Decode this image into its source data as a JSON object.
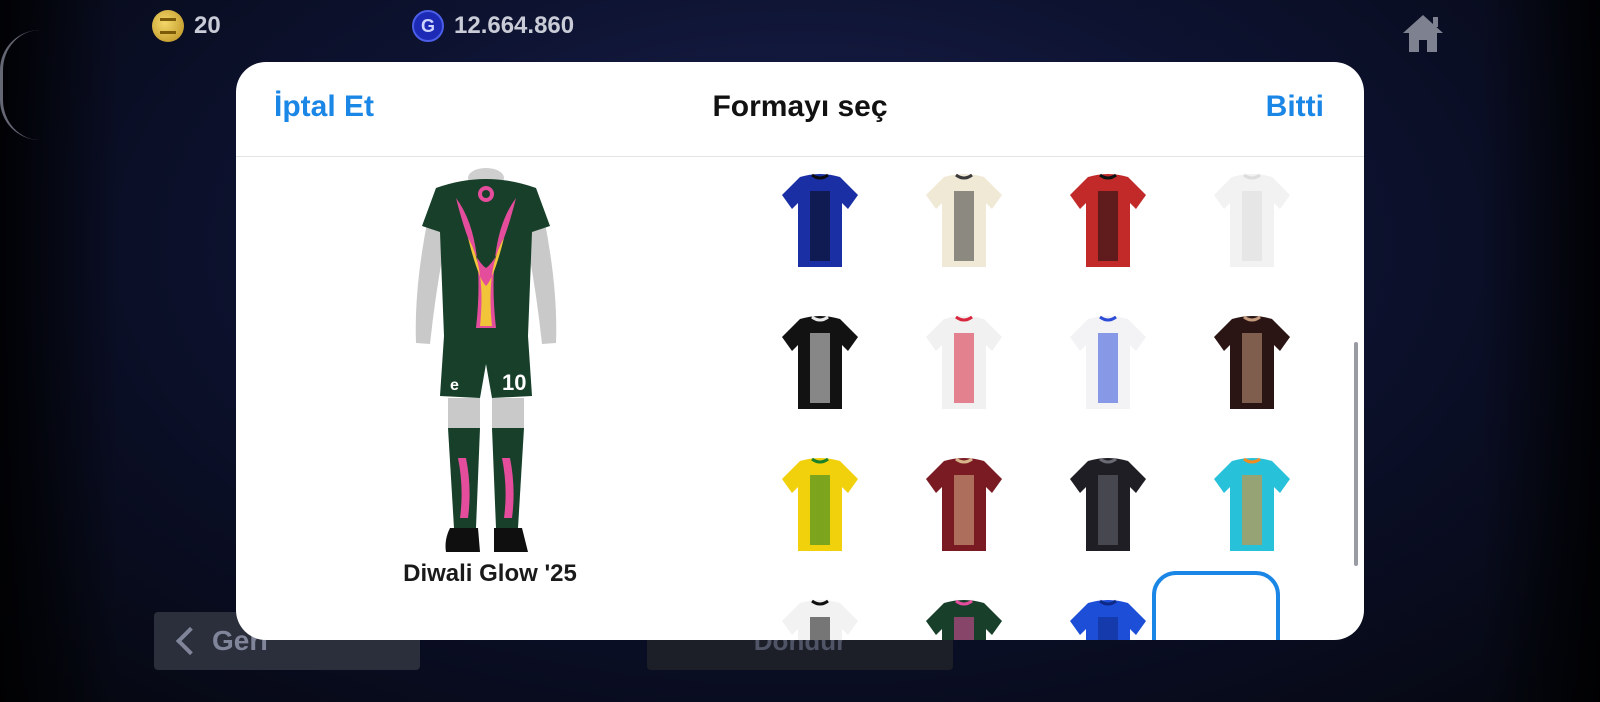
{
  "currency": {
    "coins": "20",
    "gp": "12.664.860",
    "gp_icon_letter": "G"
  },
  "background_buttons": {
    "back_label": "Geri",
    "rotate_label": "Döndür"
  },
  "modal": {
    "cancel_label": "İptal Et",
    "title": "Formayı seç",
    "done_label": "Bitti",
    "selected_kit_name": "Diwali Glow '25",
    "preview_number": "10"
  },
  "kits": [
    {
      "id": "kit-inter-stripes",
      "colors": [
        "#1a2fa3",
        "#0b0b12"
      ]
    },
    {
      "id": "kit-cream-pattern",
      "colors": [
        "#efe9d6",
        "#3a3a3a"
      ]
    },
    {
      "id": "kit-red-black",
      "colors": [
        "#c22a2a",
        "#111111"
      ]
    },
    {
      "id": "kit-white-plain",
      "colors": [
        "#f2f2f2",
        "#dcdcdc"
      ]
    },
    {
      "id": "kit-black-white-sleeves",
      "colors": [
        "#121212",
        "#e8e8e8"
      ]
    },
    {
      "id": "kit-white-red",
      "colors": [
        "#f1f1f1",
        "#d7263d"
      ]
    },
    {
      "id": "kit-white-blue-red",
      "colors": [
        "#f3f3f6",
        "#2d4dd8"
      ]
    },
    {
      "id": "kit-dark-brown-stripes",
      "colors": [
        "#2a1414",
        "#c49a7c"
      ]
    },
    {
      "id": "kit-yellow-green",
      "colors": [
        "#f1d10c",
        "#1c7f2a"
      ]
    },
    {
      "id": "kit-bayern-maroon",
      "colors": [
        "#7a1a22",
        "#d7b58a"
      ]
    },
    {
      "id": "kit-bayern-black",
      "colors": [
        "#1e1e24",
        "#6a6a74"
      ]
    },
    {
      "id": "kit-cyan-orange",
      "colors": [
        "#27c1d9",
        "#f28b20"
      ]
    },
    {
      "id": "kit-black-white-vertical",
      "colors": [
        "#f2f2f2",
        "#111111"
      ]
    },
    {
      "id": "kit-diwali-glow",
      "colors": [
        "#173f2a",
        "#e44c9c"
      ]
    },
    {
      "id": "kit-blue-pattern",
      "colors": [
        "#1d4ed8",
        "#0f2a86"
      ]
    }
  ]
}
